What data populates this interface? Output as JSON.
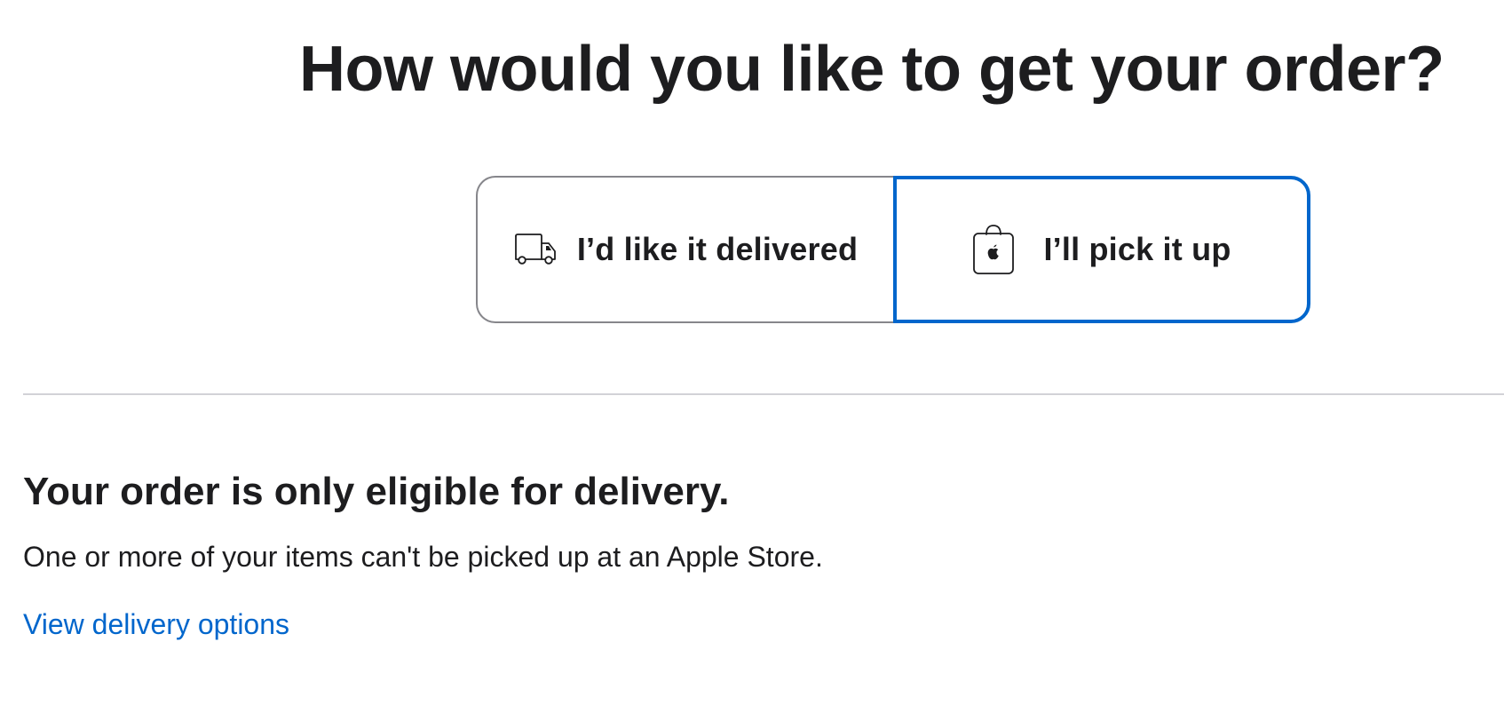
{
  "header": {
    "title": "How would you like to get your order?"
  },
  "fulfillment_options": {
    "selected": "pickup",
    "items": [
      {
        "id": "delivery",
        "icon": "truck-icon",
        "label": "I’d like it delivered"
      },
      {
        "id": "pickup",
        "icon": "apple-bag-icon",
        "label": "I’ll pick it up"
      }
    ]
  },
  "notice": {
    "title": "Your order is only eligible for delivery.",
    "body": "One or more of your items can't be picked up at an Apple Store.",
    "link": "View delivery options"
  },
  "colors": {
    "selected_border": "#0066cc",
    "unselected_border": "#86868b",
    "link": "#0066cc",
    "text": "#1d1d1f",
    "divider": "#d2d2d7"
  }
}
